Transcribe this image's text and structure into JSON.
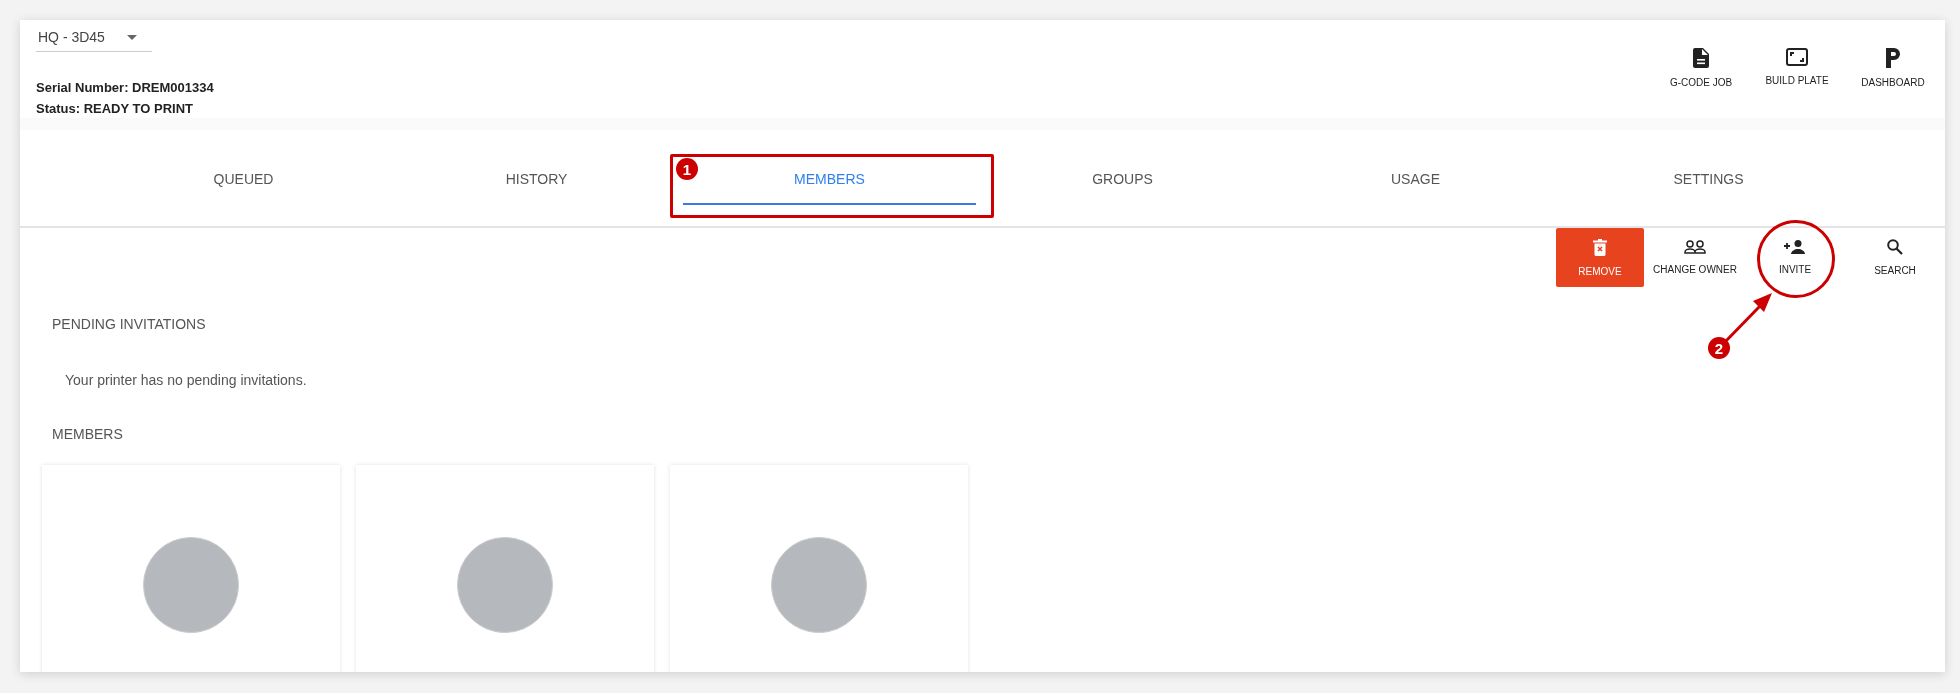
{
  "printer_select": {
    "value": "HQ - 3D45"
  },
  "info": {
    "serial": "Serial Number: DREM001334",
    "status": "Status: READY TO PRINT"
  },
  "header_actions": [
    {
      "kind": "gcode",
      "label": "G-CODE JOB"
    },
    {
      "kind": "plate",
      "label": "BUILD PLATE"
    },
    {
      "kind": "dashboard",
      "label": "DASHBOARD"
    }
  ],
  "tabs": [
    {
      "label": "QUEUED",
      "selected": false
    },
    {
      "label": "HISTORY",
      "selected": false
    },
    {
      "label": "MEMBERS",
      "selected": true,
      "callout": "1"
    },
    {
      "label": "GROUPS",
      "selected": false
    },
    {
      "label": "USAGE",
      "selected": false
    },
    {
      "label": "SETTINGS",
      "selected": false
    }
  ],
  "member_actions": [
    {
      "kind": "remove",
      "label": "REMOVE"
    },
    {
      "kind": "change-owner",
      "label": "CHANGE OWNER"
    },
    {
      "kind": "invite",
      "label": "INVITE",
      "callout": "2"
    },
    {
      "kind": "search",
      "label": "SEARCH"
    }
  ],
  "pending": {
    "heading": "PENDING INVITATIONS",
    "message": "Your printer has no pending invitations."
  },
  "members": {
    "heading": "MEMBERS",
    "cards": [
      {
        "has_avatar": true
      },
      {
        "has_avatar": true
      },
      {
        "has_avatar": true
      }
    ]
  }
}
